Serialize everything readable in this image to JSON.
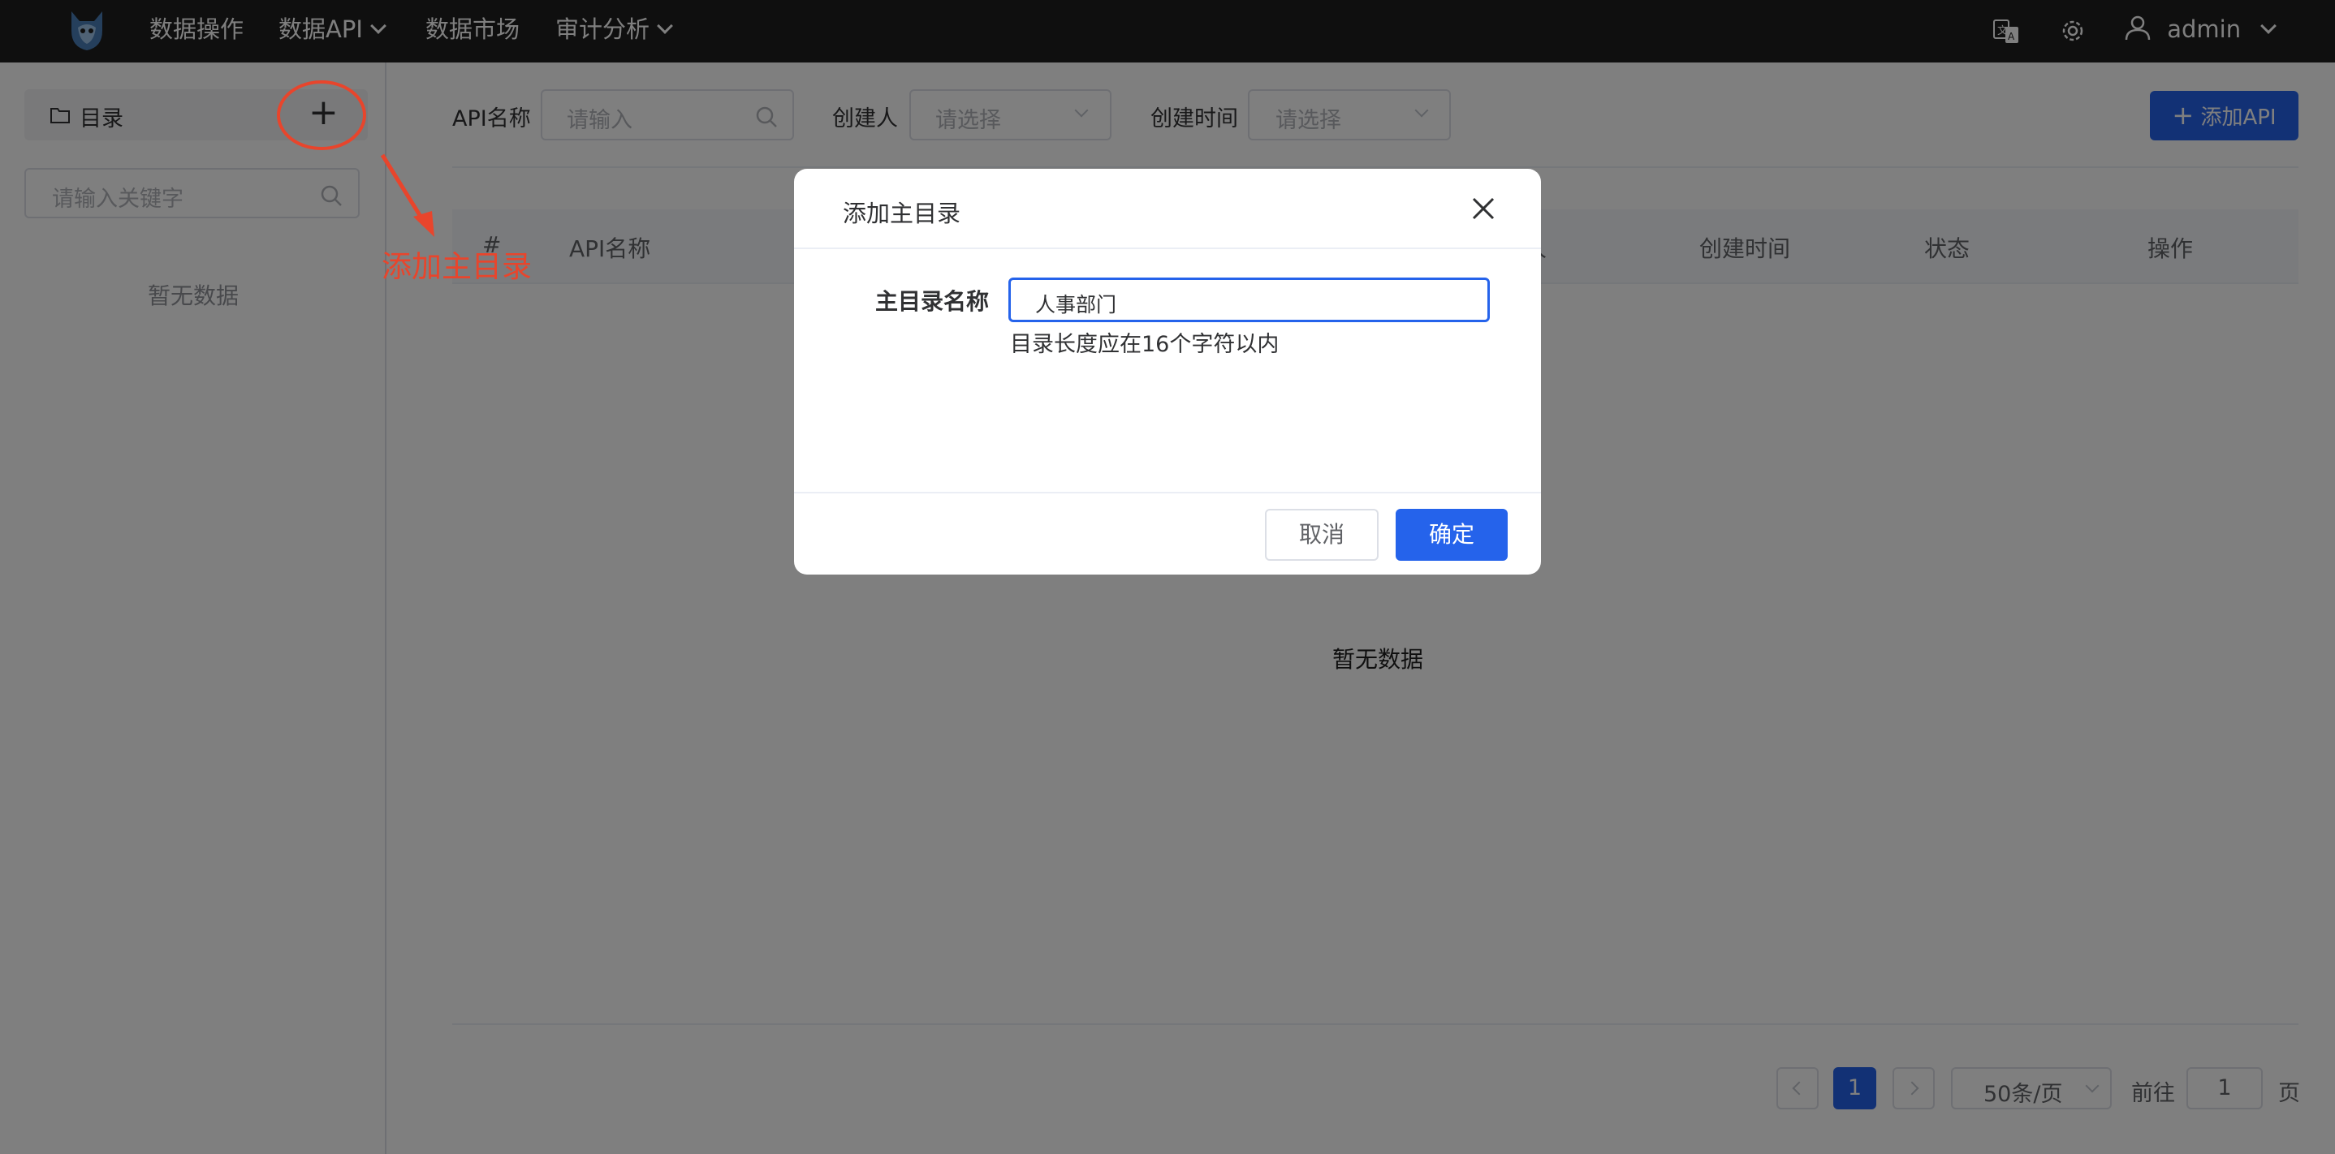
{
  "nav": {
    "items": [
      {
        "label": "数据操作"
      },
      {
        "label": "数据API"
      },
      {
        "label": "数据市场"
      },
      {
        "label": "审计分析"
      }
    ],
    "user": "admin"
  },
  "sidebar": {
    "title": "目录",
    "add_symbol": "+",
    "search_placeholder": "请输入关键字",
    "empty_text": "暂无数据"
  },
  "annotation": {
    "text": "添加主目录"
  },
  "filters": {
    "api_name_label": "API名称",
    "api_name_placeholder": "请输入",
    "creator_label": "创建人",
    "creator_placeholder": "请选择",
    "created_time_label": "创建时间",
    "created_time_placeholder": "请选择",
    "add_api_label": "添加API"
  },
  "table": {
    "columns": [
      "#",
      "API名称",
      "人",
      "创建时间",
      "状态",
      "操作"
    ],
    "empty_text": "暂无数据"
  },
  "pagination": {
    "current_page": "1",
    "page_size": "50条/页",
    "goto_label": "前往",
    "goto_value": "1",
    "page_suffix": "页"
  },
  "dialog": {
    "title": "添加主目录",
    "field_label": "主目录名称",
    "field_value": "人事部门",
    "hint": "目录长度应在16个字符以内",
    "cancel_label": "取消",
    "confirm_label": "确定"
  },
  "colors": {
    "primary": "#2563eb",
    "annotation": "#e8452c",
    "nav_bg": "#1e1e1e"
  }
}
